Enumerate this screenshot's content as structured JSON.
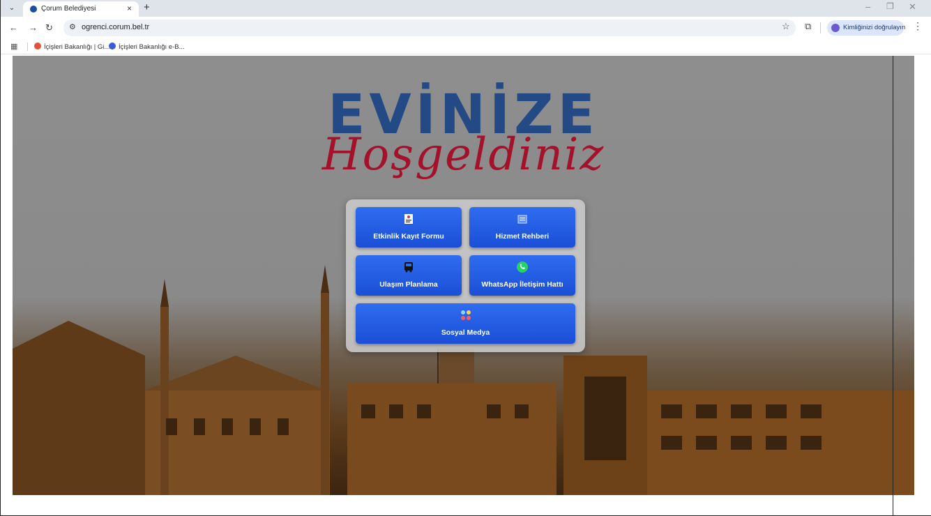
{
  "browser": {
    "tab_title": "Çorum Belediyesi",
    "tab_close": "×",
    "new_tab": "+",
    "url": "ogrenci.corum.bel.tr",
    "profile_label": "Kimliğinizi doğrulayın",
    "bookmarks": [
      {
        "label": "İçişleri Bakanlığı | Gi..."
      },
      {
        "label": "İçişleri Bakanlığı e-B..."
      }
    ]
  },
  "hero": {
    "title": "EVİNİZE",
    "subtitle": "Hoşgeldiniz"
  },
  "menu": {
    "buttons": [
      {
        "label": "Etkinlik Kayıt Formu",
        "icon": "form-icon"
      },
      {
        "label": "Hizmet Rehberi",
        "icon": "guide-icon"
      },
      {
        "label": "Ulaşım Planlama",
        "icon": "bus-icon"
      },
      {
        "label": "WhatsApp İletişim Hattı",
        "icon": "whatsapp-icon"
      },
      {
        "label": "Sosyal Medya",
        "icon": "social-media-icon"
      }
    ]
  },
  "colors": {
    "button": "#2359e6",
    "logo_blue": "#244a86",
    "logo_red": "#a3122a"
  }
}
